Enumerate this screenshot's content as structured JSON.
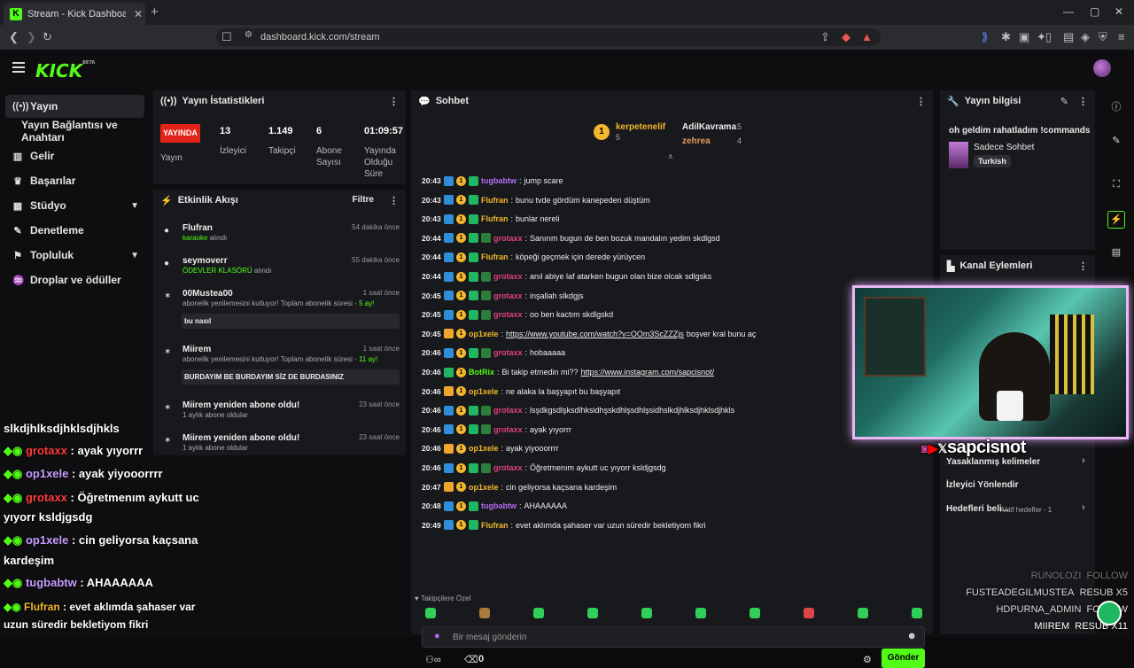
{
  "browser": {
    "tab_title": "Stream - Kick Dashboard",
    "url": "dashboard.kick.com/stream"
  },
  "app": {
    "logo": "KICK",
    "logo_badge": "BETA"
  },
  "nav": [
    {
      "label": "Yayın",
      "icon": "broadcast-icon",
      "active": true
    },
    {
      "label": "Yayın Bağlantısı ve Anahtarı",
      "icon": "key-icon"
    },
    {
      "label": "Gelir",
      "icon": "chart-icon"
    },
    {
      "label": "Başarılar",
      "icon": "trophy-icon"
    },
    {
      "label": "Stüdyo",
      "icon": "studio-icon",
      "expandable": true
    },
    {
      "label": "Denetleme",
      "icon": "wrench-icon"
    },
    {
      "label": "Topluluk",
      "icon": "community-icon",
      "expandable": true
    },
    {
      "label": "Droplar ve ödüller",
      "icon": "gift-icon"
    }
  ],
  "stats": {
    "title": "Yayın İstatistikleri",
    "live_label": "YAYINDA",
    "status_label": "Yayın",
    "viewers_value": "13",
    "viewers_label": "İzleyici",
    "followers_value": "1.149",
    "followers_label": "Takipçi",
    "subs_value": "6",
    "subs_label": "Abone Sayısı",
    "duration_value": "01:09:57",
    "duration_label": "Yayında Olduğu Süre"
  },
  "activity": {
    "title": "Etkinlik Akışı",
    "filter": "Filtre",
    "items": [
      {
        "name": "Flufran",
        "time": "54 dakika önce",
        "highlight": "karaoke",
        "desc": " alındı"
      },
      {
        "name": "seymoverr",
        "time": "55 dakika önce",
        "highlight": "ÖDEVLER KLASÖRÜ",
        "desc": " alındı"
      },
      {
        "name": "00Mustea00",
        "time": "1 saat önce",
        "desc": "abonelik yenilemesini kutluyor! Toplam abonelik süresi - ",
        "highlight": "5 ay!",
        "msg": "bu nasıl"
      },
      {
        "name": "Miirem",
        "time": "1 saat önce",
        "desc": "abonelik yenilemesini kutluyor! Toplam abonelik süresi - ",
        "highlight": "11 ay!",
        "msg": "BURDAYIM BE BURDAYIM SİZ DE BURDASINIZ"
      },
      {
        "name": "Miirem yeniden abone oldu!",
        "time": "23 saat önce",
        "desc": "1 aylık abone oldular"
      },
      {
        "name": "Miirem yeniden abone oldu!",
        "time": "23 saat önce",
        "desc": "1 aylık abone oldular"
      }
    ]
  },
  "chat": {
    "title": "Sohbet",
    "leaderboard": [
      {
        "name": "kerpetenelif",
        "count": "5"
      },
      {
        "name": "AdilKavrama",
        "count": "5"
      },
      {
        "name": "zehrea",
        "count": "4"
      }
    ],
    "messages": [
      {
        "time": "20:43",
        "user": "tugbabtw",
        "color": "#b46cf6",
        "text": "jump scare"
      },
      {
        "time": "20:43",
        "user": "Flufran",
        "color": "#f2b72c",
        "text": "bunu tvde gördüm kanepeden düştüm"
      },
      {
        "time": "20:43",
        "user": "Flufran",
        "color": "#f2b72c",
        "text": "bunlar nereli"
      },
      {
        "time": "20:44",
        "user": "grotaxx",
        "color": "#e0427b",
        "text": "Sanırım bugun de ben bozuk mandalın yedim skdlgsd"
      },
      {
        "time": "20:44",
        "user": "Flufran",
        "color": "#f2b72c",
        "text": "köpeği geçmek için derede yürüycen"
      },
      {
        "time": "20:44",
        "user": "grotaxx",
        "color": "#e0427b",
        "text": "anıl abiye laf atarken bugun olan bize olcak sdlgsks"
      },
      {
        "time": "20:45",
        "user": "grotaxx",
        "color": "#e0427b",
        "text": "inşallah slkdgjs"
      },
      {
        "time": "20:45",
        "user": "grotaxx",
        "color": "#e0427b",
        "text": "oo ben kactım skdlgskd"
      },
      {
        "time": "20:45",
        "user": "op1xele",
        "color": "#f2b72c",
        "link": "https://www.youtube.com/watch?v=OOm3ScZZZjs",
        "text": " boşver kral bunu aç"
      },
      {
        "time": "20:46",
        "user": "grotaxx",
        "color": "#e0427b",
        "text": "hobaaaaa"
      },
      {
        "time": "20:46",
        "user": "BotRix",
        "color": "#53fc18",
        "text": "Bi takip etmedin mi?? ",
        "link2": "https://www.instagram.com/sapcisnot/"
      },
      {
        "time": "20:46",
        "user": "op1xele",
        "color": "#f2b72c",
        "text": "ne alaka la başyapıt bu başyapıt"
      },
      {
        "time": "20:46",
        "user": "grotaxx",
        "color": "#e0427b",
        "text": "lsşdkgsdlşksdlhksidhşskdhlşsdhlşsidhslkdjhlksdjhklsdjhkls"
      },
      {
        "time": "20:46",
        "user": "grotaxx",
        "color": "#e0427b",
        "text": "ayak yıyorrr"
      },
      {
        "time": "20:46",
        "user": "op1xele",
        "color": "#f2b72c",
        "text": "ayak yiyooorrrr"
      },
      {
        "time": "20:46",
        "user": "grotaxx",
        "color": "#e0427b",
        "text": "Öğretmenım aykutt uc yıyorr ksldjgsdg"
      },
      {
        "time": "20:47",
        "user": "op1xele",
        "color": "#f2b72c",
        "text": "cin geliyorsa kaçsana kardeşim"
      },
      {
        "time": "20:48",
        "user": "tugbabtw",
        "color": "#b46cf6",
        "text": "AHAAAAAA"
      },
      {
        "time": "20:49",
        "user": "Flufran",
        "color": "#f2b72c",
        "text": "evet aklımda şahaser var uzun süredir bekletiyom fikri"
      }
    ],
    "followers_only": "Takipçilere Özel",
    "input_placeholder": "Bir mesaj gönderin",
    "send": "Gönder",
    "bottom_count": "0"
  },
  "stream_info": {
    "title": "Yayın bilgisi",
    "stream_title": "oh geldim rahatladım !commands",
    "category": "Sadece Sohbet",
    "language": "Turkish"
  },
  "channel_actions": {
    "title": "Kanal Eylemleri",
    "banned_words": "Yasaklanmış kelimeler",
    "raid": "İzleyici Yönlendir",
    "goals": "Hedefleri beli...",
    "goals_status": "Aktif hedefler - 1"
  },
  "overlay": {
    "chat": [
      {
        "user": "",
        "text": "slkdjhlksdjhklsdjhkls"
      },
      {
        "user": "grotaxx",
        "color": "#ff3b3b",
        "text": " : ayak yıyorrr"
      },
      {
        "user": "op1xele",
        "color": "#c89cff",
        "text": " : ayak yiyooorrrr"
      },
      {
        "user": "grotaxx",
        "color": "#ff3b3b",
        "text": " : Öğretmenım aykutt uc"
      },
      {
        "user": "",
        "text": "yıyorr ksldjgsdg"
      },
      {
        "user": "op1xele",
        "color": "#c89cff",
        "text": " : cin geliyorsa kaçsana"
      },
      {
        "user": "",
        "text": "kardeşim"
      },
      {
        "user": "tugbabtw",
        "color": "#c89cff",
        "text": " : AHAAAAAA"
      },
      {
        "user": "Flufran",
        "color": "#f2b72c",
        "text": " : evet aklımda şahaser var"
      },
      {
        "user": "",
        "text": "uzun süredir bekletiyom fikri"
      }
    ],
    "cam_handle": "sapcisnot",
    "events": [
      {
        "name": "RUNOLOZI",
        "action": "FOLLOW"
      },
      {
        "name": "FUSTEADEGILMUSTEA",
        "action": "RESUB X5"
      },
      {
        "name": "HDPURNA_ADMIN",
        "action": "FOLLOW"
      },
      {
        "name": "MIIREM",
        "action": "RESUB X11"
      }
    ]
  }
}
